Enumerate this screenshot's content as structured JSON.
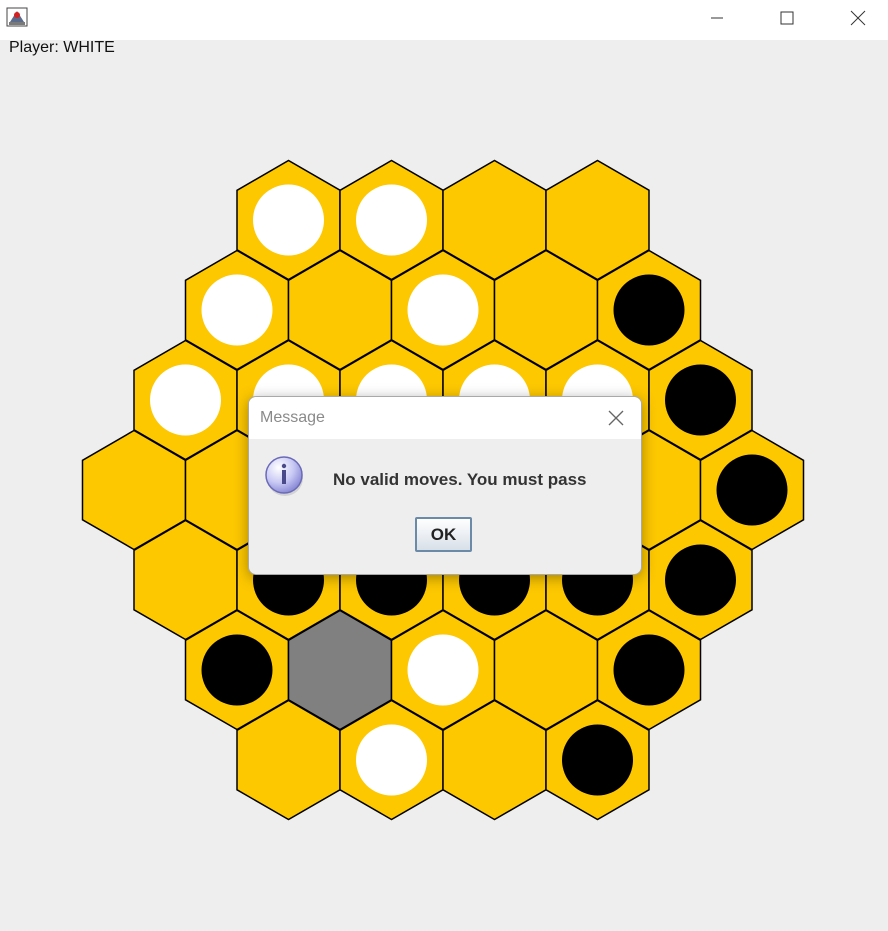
{
  "window": {
    "title": ""
  },
  "status": {
    "player_label": "Player: WHITE"
  },
  "board": {
    "rows": [
      [
        "white",
        "white",
        "empty",
        "empty"
      ],
      [
        "white",
        "empty",
        "white",
        "empty",
        "black"
      ],
      [
        "white",
        "white",
        "white",
        "white",
        "white",
        "black"
      ],
      [
        "empty",
        "empty",
        "empty",
        "empty",
        "empty",
        "empty",
        "black"
      ],
      [
        "empty",
        "black",
        "black",
        "black",
        "black",
        "black"
      ],
      [
        "black",
        "grey",
        "white",
        "empty",
        "black"
      ],
      [
        "empty",
        "white",
        "empty",
        "black"
      ]
    ],
    "colors": {
      "cell": "#fdc800",
      "highlight": "#808080",
      "white_piece": "#ffffff",
      "black_piece": "#000000",
      "border": "#000000"
    }
  },
  "dialog": {
    "title": "Message",
    "message": "No valid moves. You must pass",
    "ok_label": "OK",
    "icon": "info-icon"
  }
}
